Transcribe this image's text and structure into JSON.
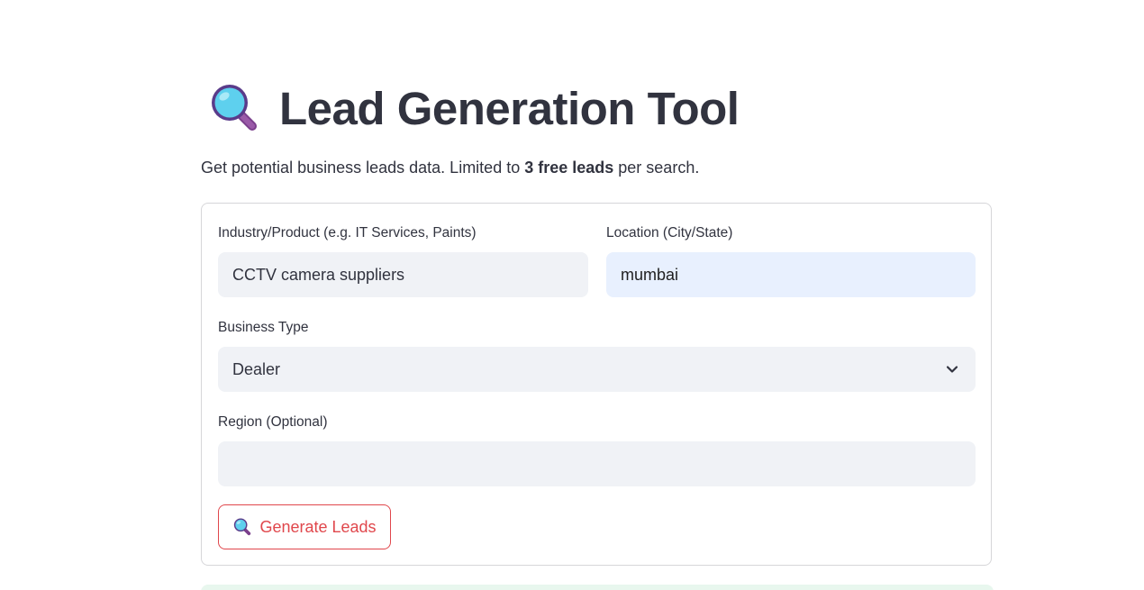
{
  "header": {
    "title": "Lead Generation Tool",
    "title_icon": "magnifying-glass-icon"
  },
  "subtitle": {
    "prefix": "Get potential business leads data. Limited to ",
    "bold": "3 free leads",
    "suffix": " per search."
  },
  "form": {
    "industry": {
      "label": "Industry/Product (e.g. IT Services, Paints)",
      "value": "CCTV camera suppliers"
    },
    "location": {
      "label": "Location (City/State)",
      "value": "mumbai"
    },
    "business_type": {
      "label": "Business Type",
      "selected": "Dealer",
      "icon": "chevron-down-icon"
    },
    "region": {
      "label": "Region (Optional)",
      "value": ""
    },
    "submit": {
      "label": "Generate Leads",
      "icon": "magnifying-glass-icon"
    }
  },
  "colors": {
    "text": "#31333f",
    "input_bg": "#f0f2f6",
    "input_focus_bg": "#e8f0fe",
    "accent": "#e0474c",
    "border": "#d6d6d9",
    "success_bg": "#e8f7ee"
  }
}
